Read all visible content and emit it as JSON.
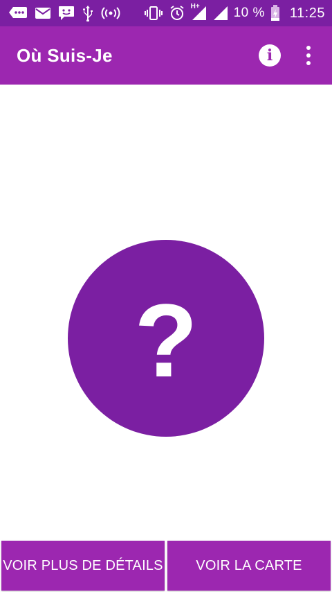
{
  "status_bar": {
    "battery_percent": "10 %",
    "clock": "11:25",
    "network": "H+",
    "icons": [
      "sms-bubble-icon",
      "email-icon",
      "chat-smiley-icon",
      "usb-icon",
      "hotspot-icon",
      "vibrate-icon",
      "alarm-icon",
      "signal-icon",
      "battery-charging-icon"
    ]
  },
  "app_bar": {
    "title": "Où Suis-Je",
    "actions": [
      "info-icon",
      "overflow-menu-icon"
    ]
  },
  "main": {
    "symbol": "?",
    "circle_color": "#7b1fa2"
  },
  "buttons": {
    "details_label": "VOIR PLUS DE DÉTAILS",
    "map_label": "VOIR LA CARTE"
  },
  "colors": {
    "status_bar": "#7b1fa2",
    "primary": "#9c27b0",
    "background": "#ffffff"
  }
}
